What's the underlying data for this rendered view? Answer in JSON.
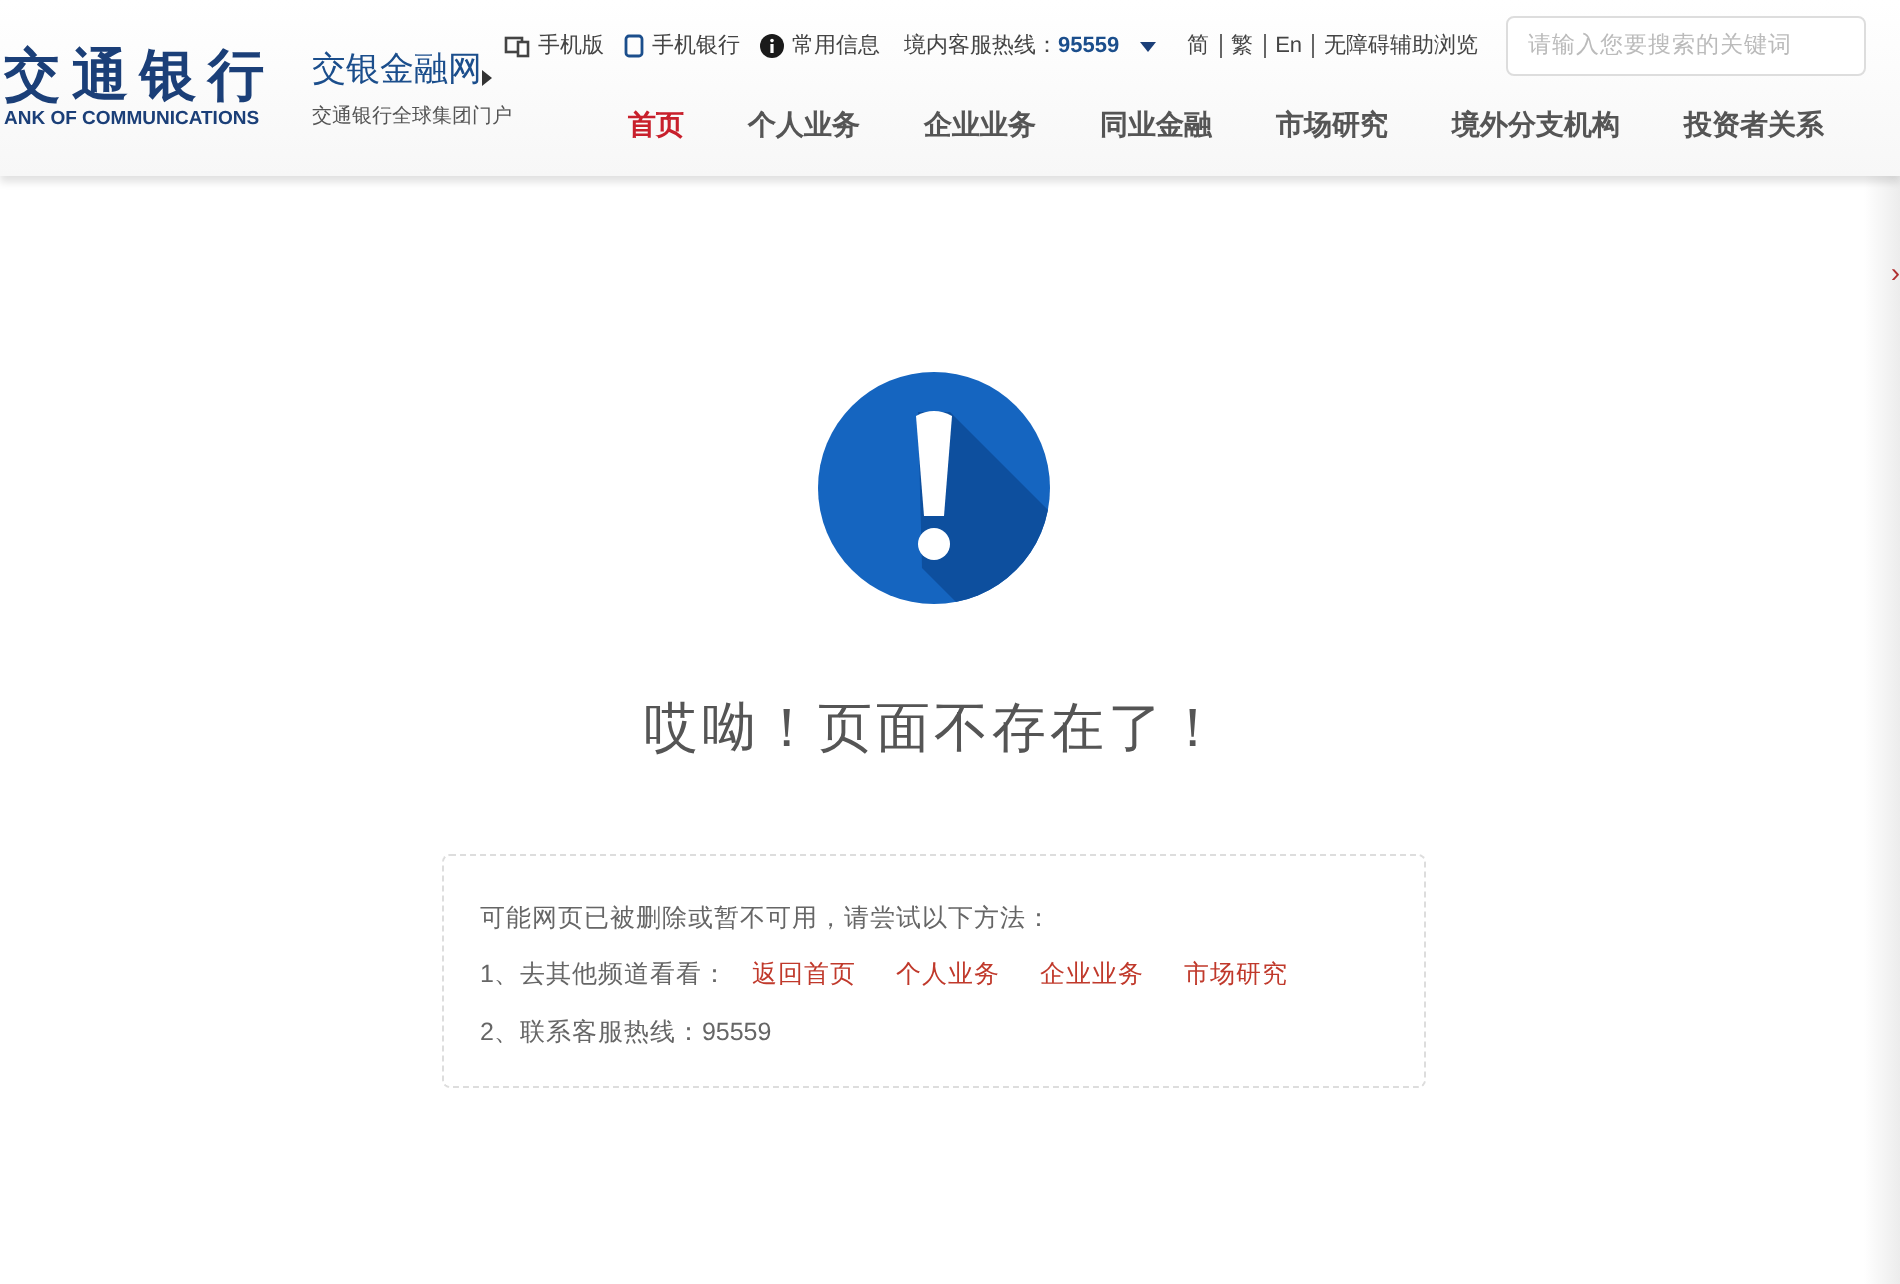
{
  "logo": {
    "name": "交通银行",
    "english": "ANK OF COMMUNICATIONS"
  },
  "portal": {
    "title": "交银金融网",
    "subtitle": "交通银行全球集团门户"
  },
  "top_links": [
    {
      "kind": "mobile",
      "label": "手机版"
    },
    {
      "kind": "tablet",
      "label": "手机银行"
    },
    {
      "kind": "info",
      "label": "常用信息"
    }
  ],
  "hotline": {
    "label": "境内客服热线：",
    "number": "95559"
  },
  "languages": [
    "简",
    "繁",
    "En",
    "无障碍辅助浏览"
  ],
  "search": {
    "placeholder": "请输入您要搜索的关键词"
  },
  "nav": [
    {
      "label": "首页",
      "selected": true
    },
    {
      "label": "个人业务",
      "selected": false
    },
    {
      "label": "企业业务",
      "selected": false
    },
    {
      "label": "同业金融",
      "selected": false
    },
    {
      "label": "市场研究",
      "selected": false
    },
    {
      "label": "境外分支机构",
      "selected": false
    },
    {
      "label": "投资者关系",
      "selected": false
    }
  ],
  "error": {
    "title": "哎呦！页面不存在了！",
    "intro": "可能网页已被删除或暂不可用，请尝试以下方法：",
    "channels_label": "1、去其他频道看看：",
    "links": [
      "返回首页",
      "个人业务",
      "企业业务",
      "市场研究"
    ],
    "contact": "2、联系客服热线：95559"
  },
  "side_panel": {
    "toggle": "›"
  }
}
